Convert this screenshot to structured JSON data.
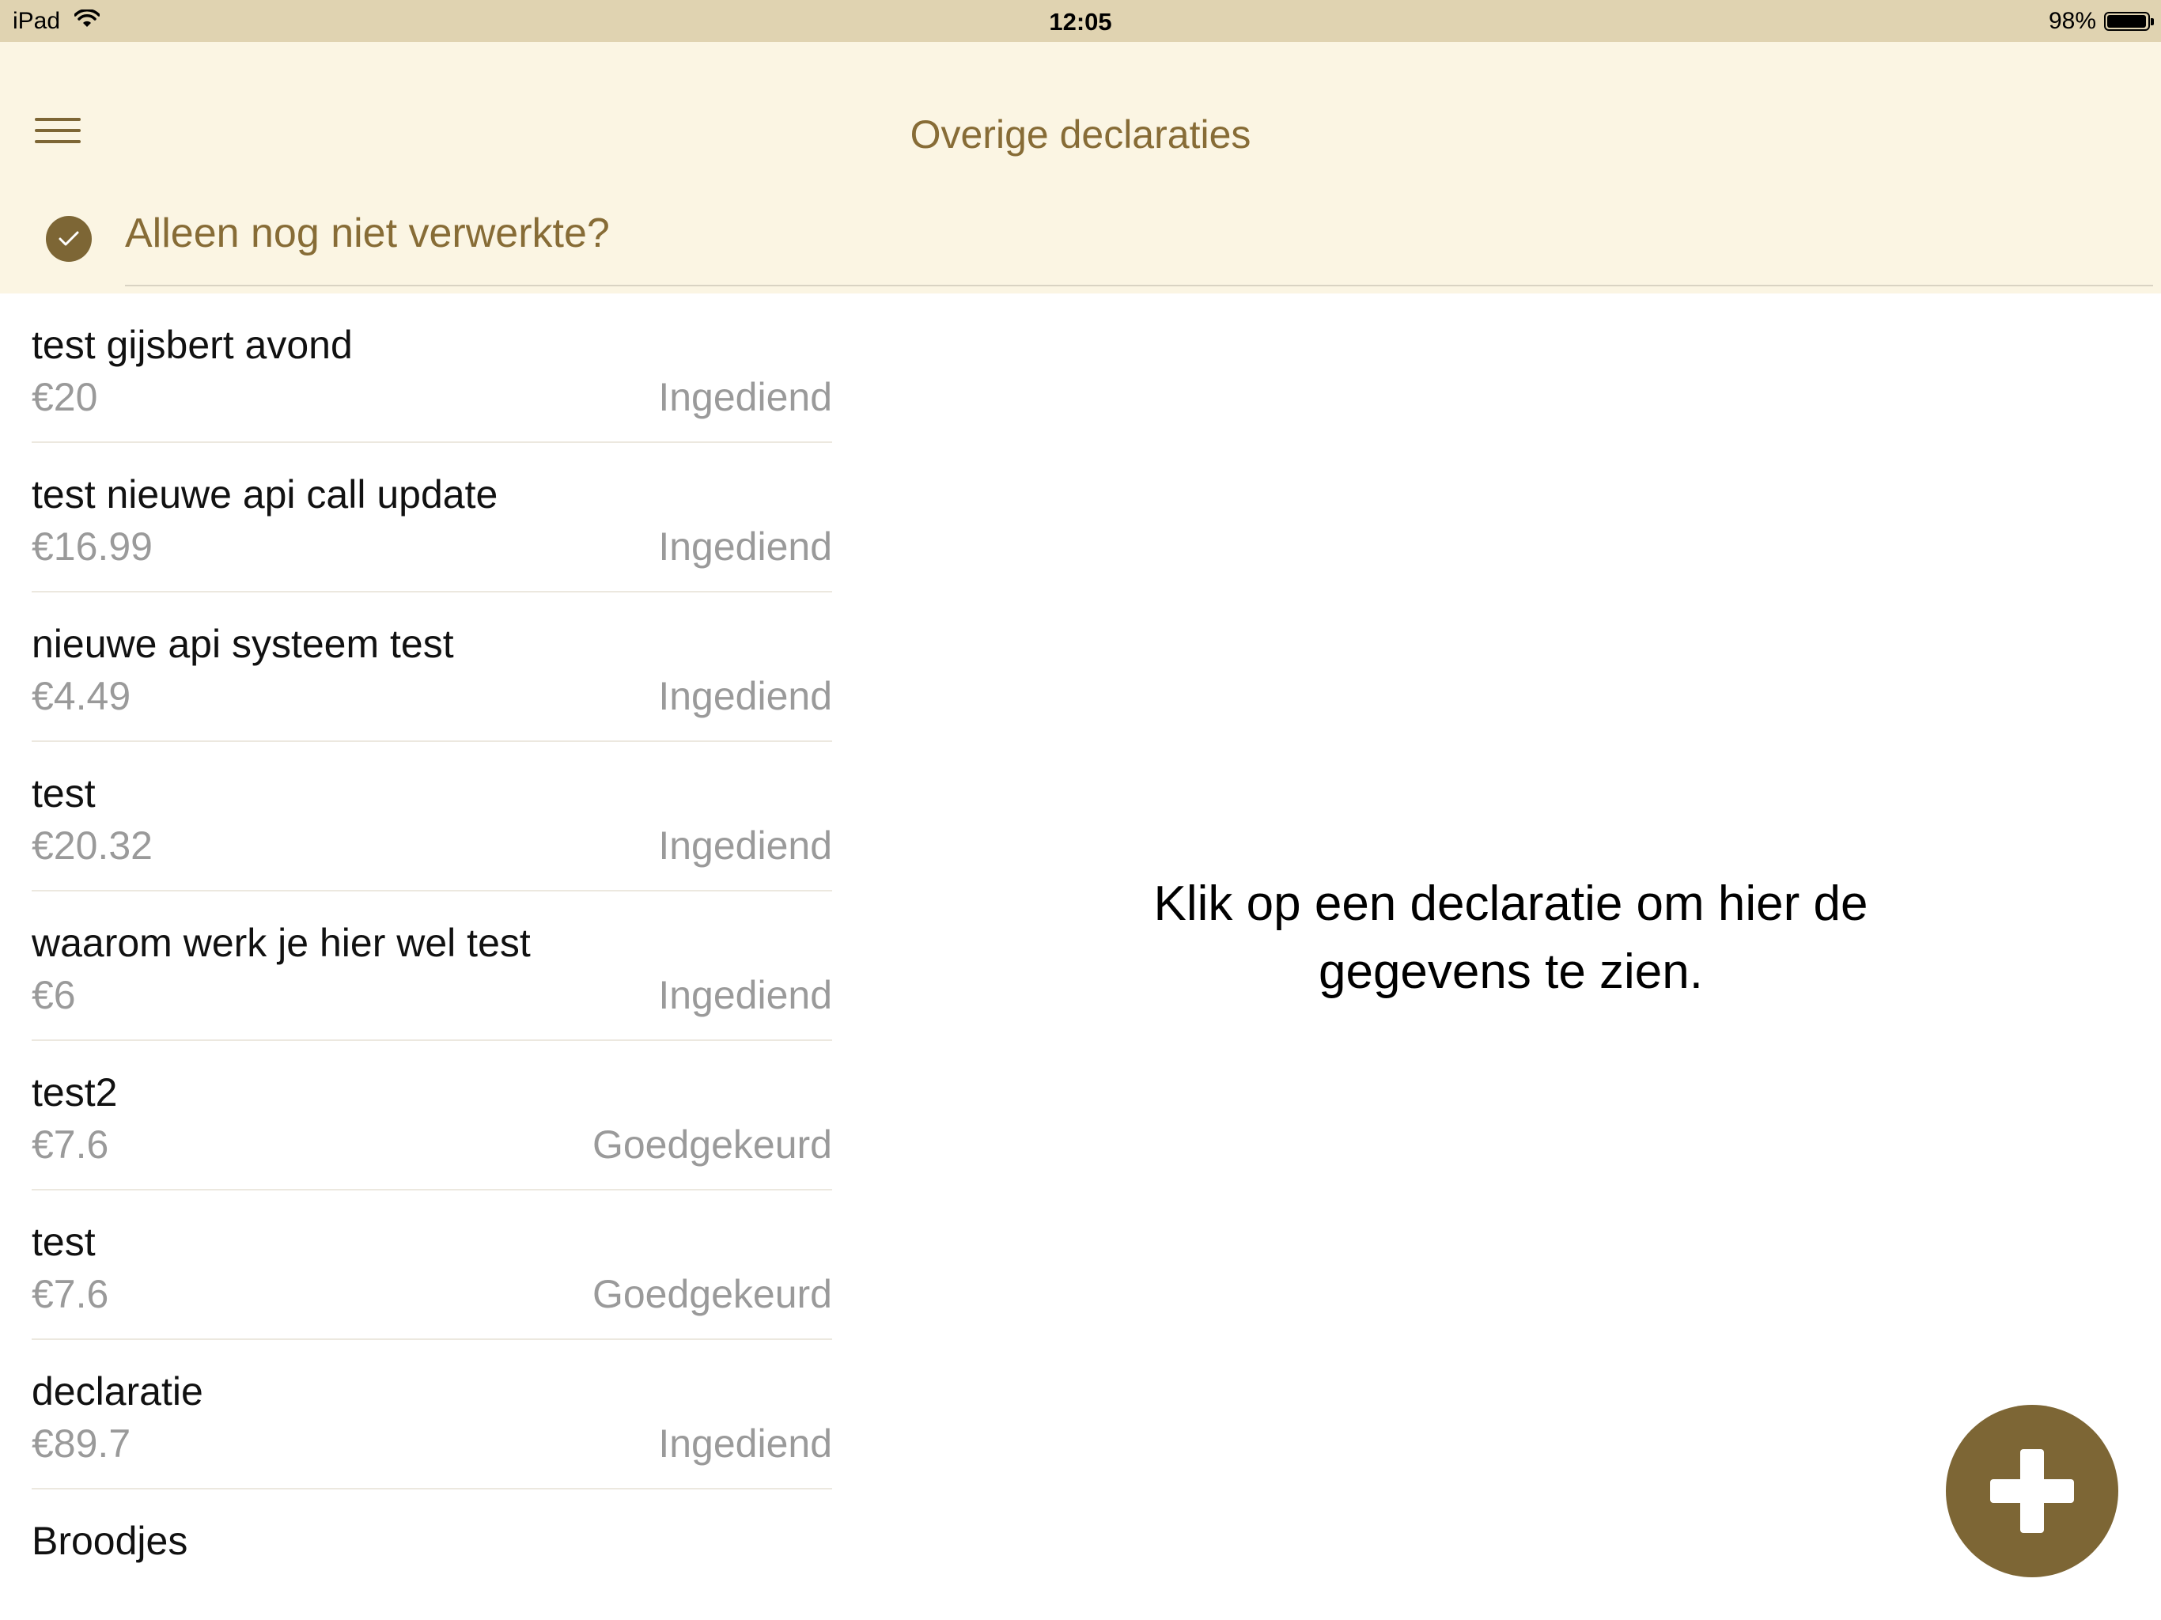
{
  "status_bar": {
    "device": "iPad",
    "time": "12:05",
    "battery": "98%",
    "battery_level": 0.98
  },
  "header": {
    "title": "Overige declaraties",
    "menu_icon": "hamburger-icon",
    "filter": {
      "label": "Alleen nog niet verwerkte?",
      "checked": true,
      "icon": "checkmark-icon"
    }
  },
  "list": {
    "items": [
      {
        "title": "test gijsbert avond",
        "amount": "€20",
        "status": "Ingediend"
      },
      {
        "title": "test nieuwe api call update",
        "amount": "€16.99",
        "status": "Ingediend"
      },
      {
        "title": "nieuwe api systeem test",
        "amount": "€4.49",
        "status": "Ingediend"
      },
      {
        "title": "test",
        "amount": "€20.32",
        "status": "Ingediend"
      },
      {
        "title": "waarom werk je hier wel test",
        "amount": "€6",
        "status": "Ingediend"
      },
      {
        "title": "test2",
        "amount": "€7.6",
        "status": "Goedgekeurd"
      },
      {
        "title": "test",
        "amount": "€7.6",
        "status": "Goedgekeurd"
      },
      {
        "title": "declaratie",
        "amount": "€89.7",
        "status": "Ingediend"
      },
      {
        "title": "Broodjes",
        "amount": "",
        "status": ""
      }
    ]
  },
  "detail": {
    "placeholder_line1": "Klik op een declaratie om hier de",
    "placeholder_line2": "gegevens te zien."
  },
  "fab": {
    "icon": "plus-icon"
  },
  "colors": {
    "accent": "#7d6635",
    "header_bg": "#fbf5e3",
    "status_bar_bg": "#e0d3b1",
    "muted_text": "#9a9a9a"
  }
}
